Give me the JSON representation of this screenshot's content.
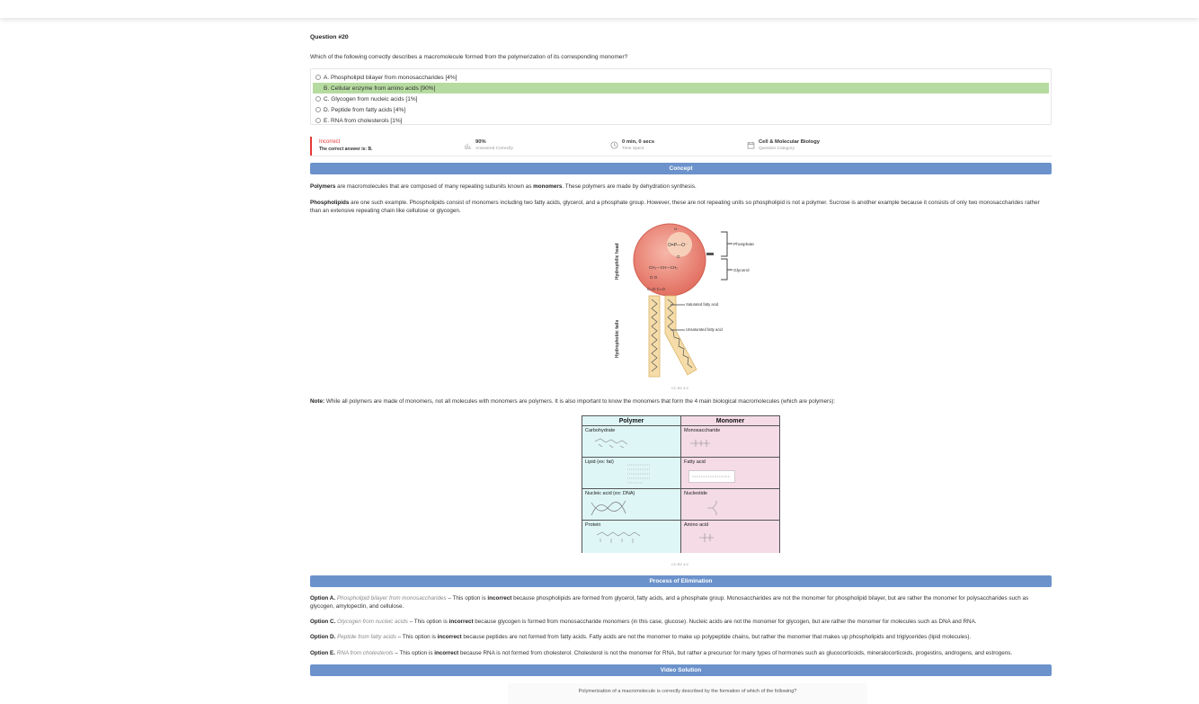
{
  "question": {
    "number": "Question #20",
    "text": "Which of the following correctly describes a macromolecule formed from the polymerization of its corresponding monomer?"
  },
  "choices": [
    {
      "label": "A. Phospholipid bilayer from monosaccharides [4%]",
      "correct": false
    },
    {
      "label": "B. Cellular enzyme from amino acids [90%]",
      "correct": true
    },
    {
      "label": "C. Glycogen from nucleic acids [1%]",
      "correct": false
    },
    {
      "label": "D. Peptide from fatty acids [4%]",
      "correct": false
    },
    {
      "label": "E. RNA from cholesterols [1%]",
      "correct": false
    }
  ],
  "stats": {
    "result": "Incorrect",
    "result_sub": "The correct answer is: B.",
    "percent": "90%",
    "percent_caption": "Answered Correctly",
    "time": "0 min, 0 secs",
    "time_caption": "Time Spent",
    "category": "Cell & Molecular Biology",
    "category_caption": "Question Category"
  },
  "concept": {
    "header": "Concept",
    "p1": {
      "b1": "Polymers",
      "t1": " are macromolecules that are composed of many repeating subunits known as ",
      "b2": "monomers",
      "t2": ". These polymers are made by dehydration synthesis."
    },
    "p2": {
      "b1": "Phospholipids",
      "t1": " are one such example. Phospholipids consist of monomers including two fatty acids, glycerol, and a phosphate group. However, these are not repeating units so phospholipid is not a polymer. Sucrose is another example because it consists of only two monosaccharides rather than an extensive repeating chain like cellulose or glycogen."
    },
    "figure": {
      "head_label": "Hydrophilic head",
      "tails_label": "Hydrophobic tails",
      "phosphate": "Phosphate",
      "glycerol": "Glycerol",
      "saturated": "Saturated fatty acid",
      "unsaturated": "Unsaturated fatty acid",
      "credit": "CC BY 4.0"
    },
    "note": {
      "b1": "Note:",
      "t1": " While all polymers are made of monomers, not all molecules with monomers are polymers. It is also important to know the monomers that form the 4 main biological macromolecules (which are polymers):"
    },
    "table": {
      "headers": [
        "Polymer",
        "Monomer"
      ],
      "rows": [
        [
          "Carbohydrate",
          "Monosaccharide"
        ],
        [
          "Lipid (ex: fat)",
          "Fatty acid"
        ],
        [
          "Nucleic acid (ex: DNA)",
          "Nucleotide"
        ],
        [
          "Protein",
          "Amino acid"
        ]
      ],
      "credit": "CC BY 4.0"
    }
  },
  "elimination": {
    "header": "Process of Elimination",
    "items": [
      {
        "opt": "Option A.",
        "name": "Phospholipid bilayer from monosaccharides",
        "pre": " – This option is ",
        "kw": "incorrect",
        "post": " because phospholipids are formed from glycerol, fatty acids, and a phosphate group. Monosaccharides are not the monomer for phospholipid bilayer, but are rather the monomer for polysaccharides such as glycogen, amylopectin, and cellulose."
      },
      {
        "opt": "Option C.",
        "name": "Glycogen from nucleic acids",
        "pre": " – This option is ",
        "kw": "incorrect",
        "post": " because glycogen is formed from monosaccharide monomers (in this case, glucose). Nucleic acids are not the monomer for glycogen, but are rather the monomer for molecules such as DNA and RNA."
      },
      {
        "opt": "Option D.",
        "name": "Peptide from fatty acids",
        "pre": " – This option is ",
        "kw": "incorrect",
        "post": " because peptides are not formed from fatty acids. Fatty acids are not the monomer to make up polypeptide chains, but rather the monomer that makes up phospholipids and triglycerides (lipid molecules)."
      },
      {
        "opt": "Option E.",
        "name": "RNA from cholesterols",
        "pre": " – This option is ",
        "kw": "incorrect",
        "post": " because RNA is not formed from cholesterol. Cholesterol is not the monomer for RNA, but rather a precursor for many types of hormones such as glucocorticoids, mineralocorticoids, progestins, androgens, and estrogens."
      }
    ]
  },
  "video": {
    "header": "Video Solution",
    "question": "Polymerization of a macromolecule is correctly described by the formation of which of the following?"
  }
}
